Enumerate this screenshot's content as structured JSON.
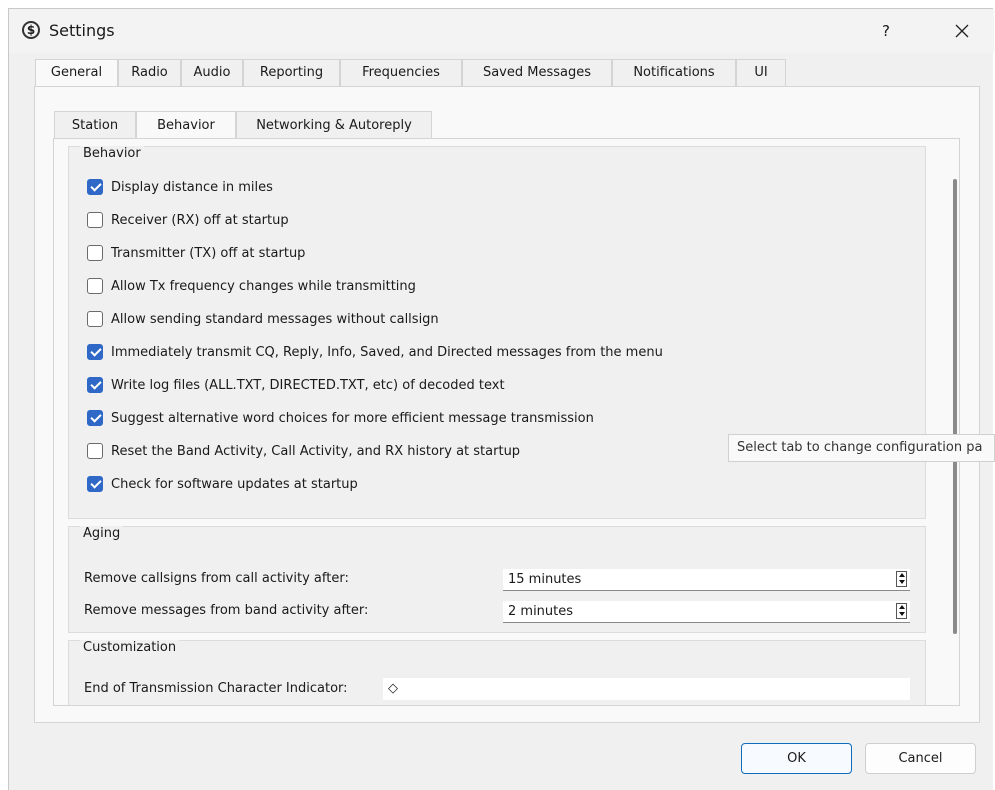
{
  "window": {
    "title": "Settings",
    "app_icon_glyph": "$",
    "help_label": "?",
    "close_label": "✕"
  },
  "outer_tabs": [
    {
      "label": "General",
      "active": true
    },
    {
      "label": "Radio",
      "active": false
    },
    {
      "label": "Audio",
      "active": false
    },
    {
      "label": "Reporting",
      "active": false
    },
    {
      "label": "Frequencies",
      "active": false
    },
    {
      "label": "Saved Messages",
      "active": false
    },
    {
      "label": "Notifications",
      "active": false
    },
    {
      "label": "UI",
      "active": false
    }
  ],
  "inner_tabs": [
    {
      "label": "Station",
      "active": false
    },
    {
      "label": "Behavior",
      "active": true
    },
    {
      "label": "Networking & Autoreply",
      "active": false
    }
  ],
  "behavior": {
    "group_title": "Behavior",
    "options": [
      {
        "label": "Display distance in miles",
        "checked": true
      },
      {
        "label": "Receiver (RX) off at startup",
        "checked": false
      },
      {
        "label": "Transmitter (TX) off at startup",
        "checked": false
      },
      {
        "label": "Allow Tx frequency changes while transmitting",
        "checked": false
      },
      {
        "label": "Allow sending standard messages without callsign",
        "checked": false
      },
      {
        "label": "Immediately transmit CQ, Reply, Info, Saved, and Directed messages from the menu",
        "checked": true
      },
      {
        "label": "Write log files (ALL.TXT, DIRECTED.TXT, etc) of decoded text",
        "checked": true
      },
      {
        "label": "Suggest alternative word choices for more efficient message transmission",
        "checked": true
      },
      {
        "label": "Reset the Band Activity, Call Activity, and RX history at startup",
        "checked": false
      },
      {
        "label": "Check for software updates at startup",
        "checked": true
      }
    ]
  },
  "aging": {
    "group_title": "Aging",
    "call_activity_label": "Remove callsigns from call activity after:",
    "call_activity_value": "15 minutes",
    "band_activity_label": "Remove messages from band activity after:",
    "band_activity_value": "2 minutes"
  },
  "customization": {
    "group_title": "Customization",
    "eot_label": "End of Transmission Character Indicator:",
    "eot_value": "◇"
  },
  "tooltip": "Select tab to change configuration pa",
  "buttons": {
    "ok_label": "OK",
    "cancel_label": "Cancel"
  },
  "colors": {
    "accent": "#2f68c7",
    "default_button_border": "#0f6cbd"
  },
  "icons": {
    "app": "app-logo-icon",
    "help": "question-icon",
    "close": "close-icon",
    "check": "checkmark-icon",
    "spin": "spin-arrows-icon"
  }
}
